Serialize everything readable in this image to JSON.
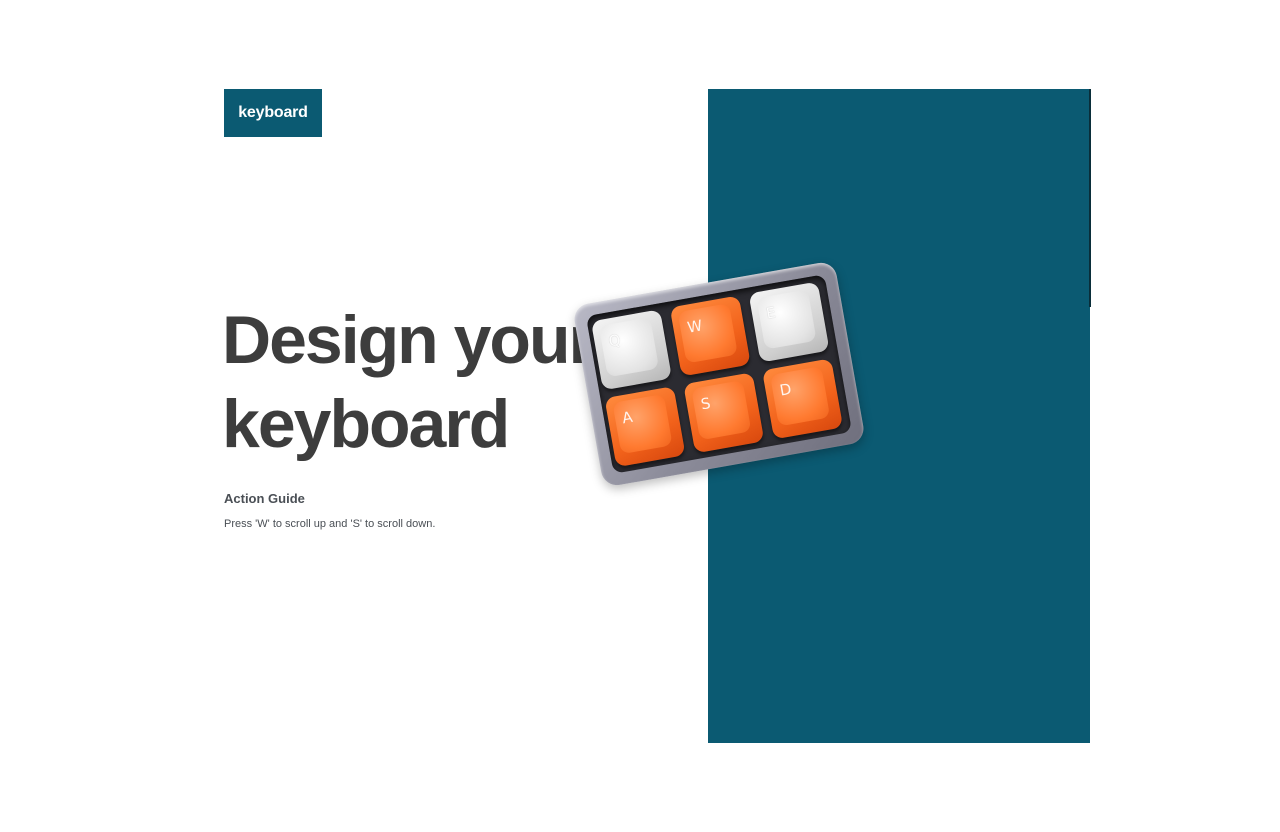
{
  "brand": {
    "logo_text": "keyboard",
    "accent_color": "#0b5a72"
  },
  "hero": {
    "headline_line1": "Design your",
    "headline_line2": "keyboard"
  },
  "guide": {
    "title": "Action Guide",
    "text": "Press 'W' to scroll up and 'S' to scroll down."
  },
  "illustration": {
    "keys": [
      {
        "label": "Q",
        "color": "white"
      },
      {
        "label": "W",
        "color": "orange"
      },
      {
        "label": "E",
        "color": "white"
      },
      {
        "label": "A",
        "color": "orange"
      },
      {
        "label": "S",
        "color": "orange"
      },
      {
        "label": "D",
        "color": "orange"
      }
    ],
    "white_key_color": "#e4e4e4",
    "orange_key_color": "#ff7a30"
  }
}
